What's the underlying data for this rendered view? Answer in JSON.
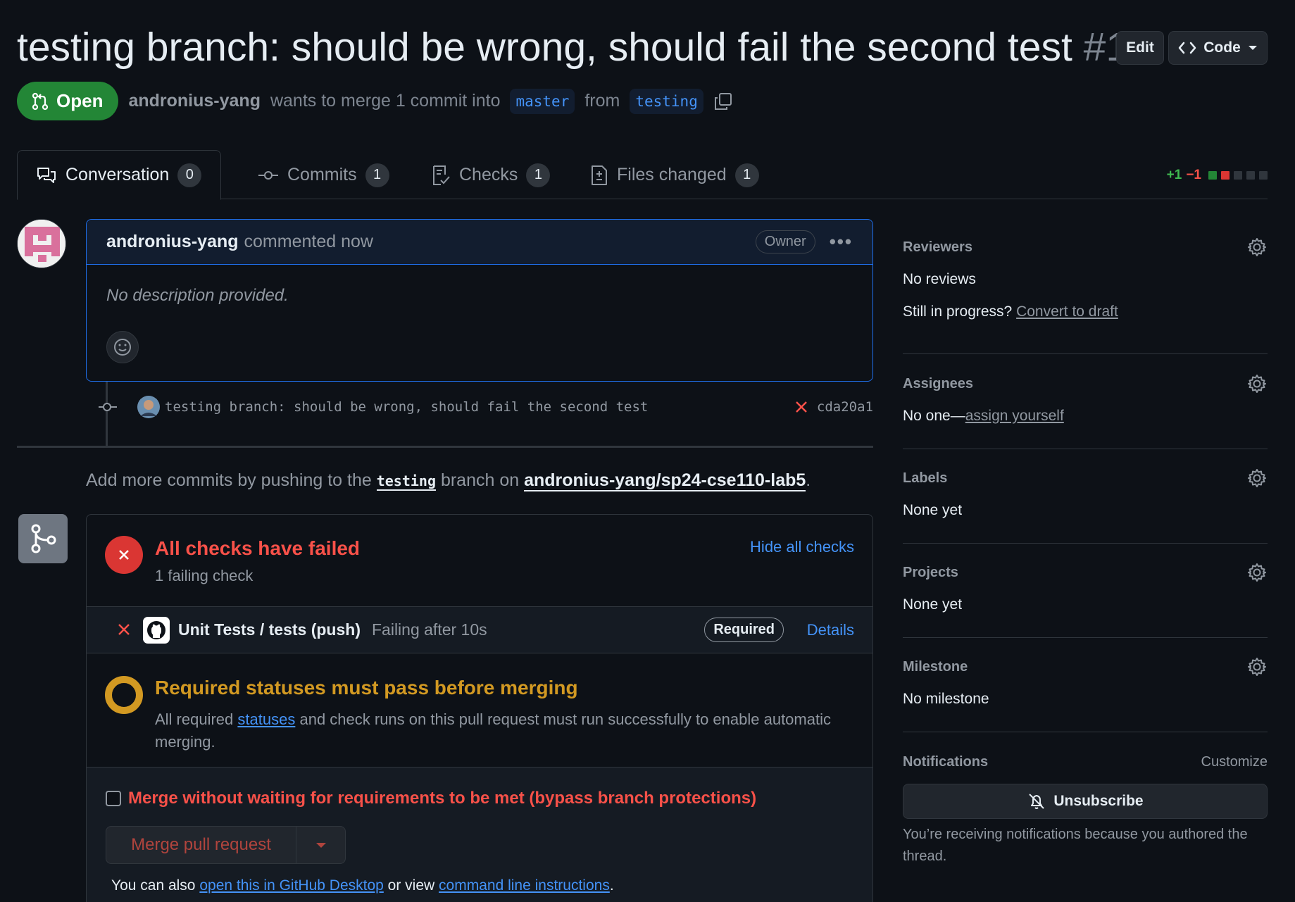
{
  "header": {
    "title": "testing branch: should be wrong, should fail the second test",
    "number": "#1",
    "edit_label": "Edit",
    "code_label": "Code"
  },
  "meta": {
    "state": "Open",
    "author": "andronius-yang",
    "action": "wants to merge 1 commit into",
    "base_branch": "master",
    "from": "from",
    "head_branch": "testing"
  },
  "tabs": [
    {
      "label": "Conversation",
      "count": "0"
    },
    {
      "label": "Commits",
      "count": "1"
    },
    {
      "label": "Checks",
      "count": "1"
    },
    {
      "label": "Files changed",
      "count": "1"
    }
  ],
  "diffstat": {
    "additions": "+1",
    "deletions": "−1"
  },
  "comment": {
    "author": "andronius-yang",
    "time": "commented now",
    "role": "Owner",
    "body": "No description provided."
  },
  "commit": {
    "message": "testing branch: should be wrong, should fail the second test",
    "sha": "cda20a1"
  },
  "hint": {
    "prefix": "Add more commits by pushing to the",
    "branch": "testing",
    "middle": "branch on",
    "repo": "andronius-yang/sp24-cse110-lab5",
    "suffix": "."
  },
  "checks": {
    "title": "All checks have failed",
    "subtitle": "1 failing check",
    "hide_label": "Hide all checks",
    "item_name": "Unit Tests / tests (push)",
    "item_status": "Failing after 10s",
    "required_label": "Required",
    "details_label": "Details"
  },
  "requirements": {
    "title": "Required statuses must pass before merging",
    "text_before": "All required",
    "link": "statuses",
    "text_after": "and check runs on this pull request must run successfully to enable automatic merging."
  },
  "merge": {
    "bypass_label": "Merge without waiting for requirements to be met (bypass branch protections)",
    "button_label": "Merge pull request",
    "also_prefix": "You can also",
    "desktop_link": "open this in GitHub Desktop",
    "or_view": "or view",
    "cli_link": "command line instructions",
    "period": "."
  },
  "sidebar": {
    "reviewers": {
      "heading": "Reviewers",
      "value": "No reviews",
      "progress_q": "Still in progress?",
      "draft_link": "Convert to draft"
    },
    "assignees": {
      "heading": "Assignees",
      "value": "No one—",
      "assign_link": "assign yourself"
    },
    "labels": {
      "heading": "Labels",
      "value": "None yet"
    },
    "projects": {
      "heading": "Projects",
      "value": "None yet"
    },
    "milestone": {
      "heading": "Milestone",
      "value": "No milestone"
    },
    "notifications": {
      "heading": "Notifications",
      "customize": "Customize",
      "button": "Unsubscribe",
      "note": "You’re receiving notifications because you authored the thread."
    }
  }
}
